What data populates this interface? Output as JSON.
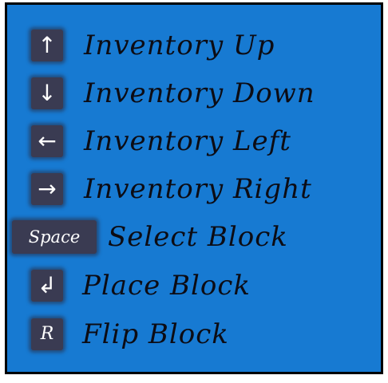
{
  "controls": [
    {
      "key": "↑",
      "action": "Inventory Up"
    },
    {
      "key": "↓",
      "action": "Inventory Down"
    },
    {
      "key": "←",
      "action": "Inventory Left"
    },
    {
      "key": "→",
      "action": "Inventory Right"
    },
    {
      "key": "Space",
      "action": "Select Block"
    },
    {
      "key": "↲",
      "action": "Place Block"
    },
    {
      "key": "R",
      "action": "Flip Block"
    }
  ]
}
